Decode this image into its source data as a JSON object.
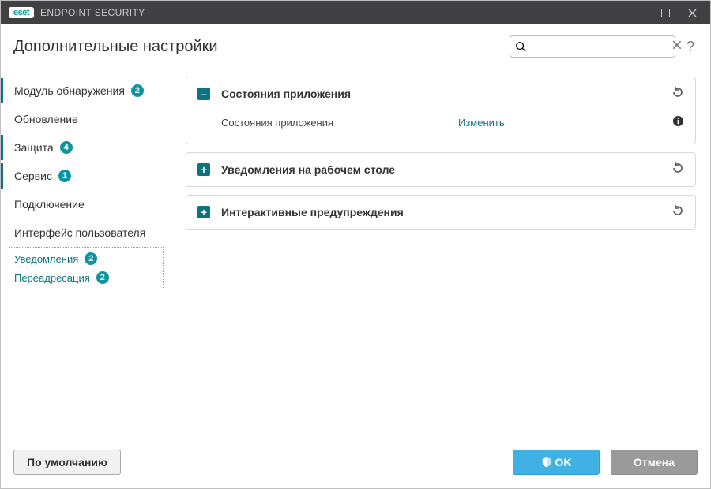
{
  "titlebar": {
    "brand": "eset",
    "app_title": "ENDPOINT SECURITY"
  },
  "page_title": "Дополнительные настройки",
  "search": {
    "placeholder": ""
  },
  "help_label": "?",
  "sidebar": {
    "items": [
      {
        "label": "Модуль обнаружения",
        "badge": "2"
      },
      {
        "label": "Обновление",
        "badge": ""
      },
      {
        "label": "Защита",
        "badge": "4"
      },
      {
        "label": "Сервис",
        "badge": "1"
      },
      {
        "label": "Подключение",
        "badge": ""
      },
      {
        "label": "Интерфейс пользователя",
        "badge": ""
      }
    ],
    "sub": [
      {
        "label": "Уведомления",
        "badge": "2"
      },
      {
        "label": "Переадресация",
        "badge": "2"
      }
    ]
  },
  "panels": [
    {
      "title": "Состояния приложения",
      "expanded": true,
      "rows": [
        {
          "label": "Состояния приложения",
          "link": "Изменить"
        }
      ]
    },
    {
      "title": "Уведомления на рабочем столе",
      "expanded": false
    },
    {
      "title": "Интерактивные предупреждения",
      "expanded": false
    }
  ],
  "footer": {
    "default": "По умолчанию",
    "ok": "OK",
    "cancel": "Отмена"
  },
  "glyph": {
    "minus": "–",
    "plus": "+"
  }
}
